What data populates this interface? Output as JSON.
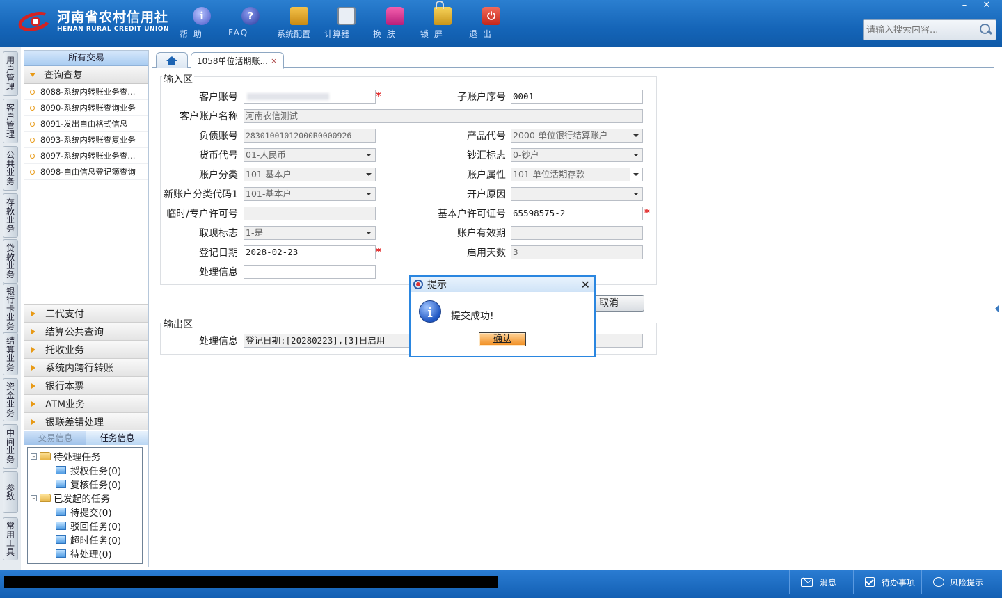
{
  "brand": {
    "cn": "河南省农村信用社",
    "en": "HENAN RURAL CREDIT UNION"
  },
  "toolbar": [
    {
      "label": "帮 助",
      "icon": "help-icon"
    },
    {
      "label": "FAQ",
      "icon": "faq-icon"
    },
    {
      "label": "系统配置",
      "icon": "settings-icon"
    },
    {
      "label": "计算器",
      "icon": "calculator-icon"
    },
    {
      "label": "换 肤",
      "icon": "skin-icon"
    },
    {
      "label": "锁 屏",
      "icon": "lock-icon"
    },
    {
      "label": "退 出",
      "icon": "exit-icon"
    }
  ],
  "window": {
    "minimize": "–",
    "close": "✕"
  },
  "search": {
    "placeholder": "请输入搜索内容..."
  },
  "icons": {
    "help": "i",
    "faq": "?",
    "exit": "⏻",
    "info": "i",
    "close": "✕",
    "tab_close": "×",
    "tree_minus": "–"
  },
  "vtabs": [
    "用户管理",
    "客户管理",
    "公共业务",
    "存款业务",
    "贷款业务",
    "银行卡业务",
    "结算业务",
    "资金业务",
    "中间业务",
    "参数",
    "常用工具"
  ],
  "left_panel": {
    "title": "所有交易",
    "open_section": "查询查复",
    "items": [
      "8088-系统内转账业务查...",
      "8090-系统内转账查询业务",
      "8091-发出自由格式信息",
      "8093-系统内转账查复业务",
      "8097-系统内转账业务查...",
      "8098-自由信息登记簿查询"
    ],
    "sections": [
      "二代支付",
      "结算公共查询",
      "托收业务",
      "系统内跨行转账",
      "银行本票",
      "ATM业务",
      "银联差错处理"
    ],
    "info_tabs": [
      "交易信息",
      "任务信息"
    ],
    "tree": {
      "pending": "待处理任务",
      "pending_children": [
        "授权任务(0)",
        "复核任务(0)"
      ],
      "initiated": "已发起的任务",
      "initiated_children": [
        "待提交(0)",
        "驳回任务(0)",
        "超时任务(0)",
        "待处理(0)"
      ]
    }
  },
  "tabs": {
    "doc_tab": "1058单位活期账..."
  },
  "form": {
    "input_title": "输入区",
    "output_title": "输出区",
    "labels": {
      "account_no": "客户账号",
      "sub_account_no": "子账户序号",
      "account_name": "客户账户名称",
      "liability_account": "负债账号",
      "product_code": "产品代号",
      "currency": "货币代号",
      "cash_flag": "钞汇标志",
      "account_category": "账户分类",
      "account_attr": "账户属性",
      "new_category_code": "新账户分类代码1",
      "open_reason": "开户原因",
      "temp_license": "临时/专户许可号",
      "basic_license": "基本户许可证号",
      "withdraw_flag": "取现标志",
      "account_validity": "账户有效期",
      "register_date": "登记日期",
      "active_days": "启用天数",
      "process_info": "处理信息",
      "out_process_info": "处理信息"
    },
    "values": {
      "account_no": "",
      "sub_account_no": "0001",
      "account_name": "河南农信测试",
      "liability_account": "28301001012000R0000926",
      "product_code": "2000-单位银行结算账户",
      "currency": "01-人民币",
      "cash_flag": "0-钞户",
      "account_category": "101-基本户",
      "account_attr": "101-单位活期存款",
      "new_category_code": "101-基本户",
      "open_reason": "",
      "temp_license": "",
      "basic_license": "65598575-2",
      "withdraw_flag": "1-是",
      "account_validity": "",
      "register_date": "2028-02-23",
      "active_days": "3",
      "process_info": "",
      "out_process_info": "登记日期:[20280223],[3]日启用"
    },
    "required_mark": "*",
    "cancel": "取消"
  },
  "dialog": {
    "title": "提示",
    "message": "提交成功!",
    "ok": "确认"
  },
  "statusbar": {
    "messages": "消息",
    "todo": "待办事项",
    "risk": "风险提示"
  },
  "colors": {
    "header": "#1565b8",
    "accent": "#2a86e0",
    "required": "#e02020",
    "ok_button": "#f08c1e"
  }
}
